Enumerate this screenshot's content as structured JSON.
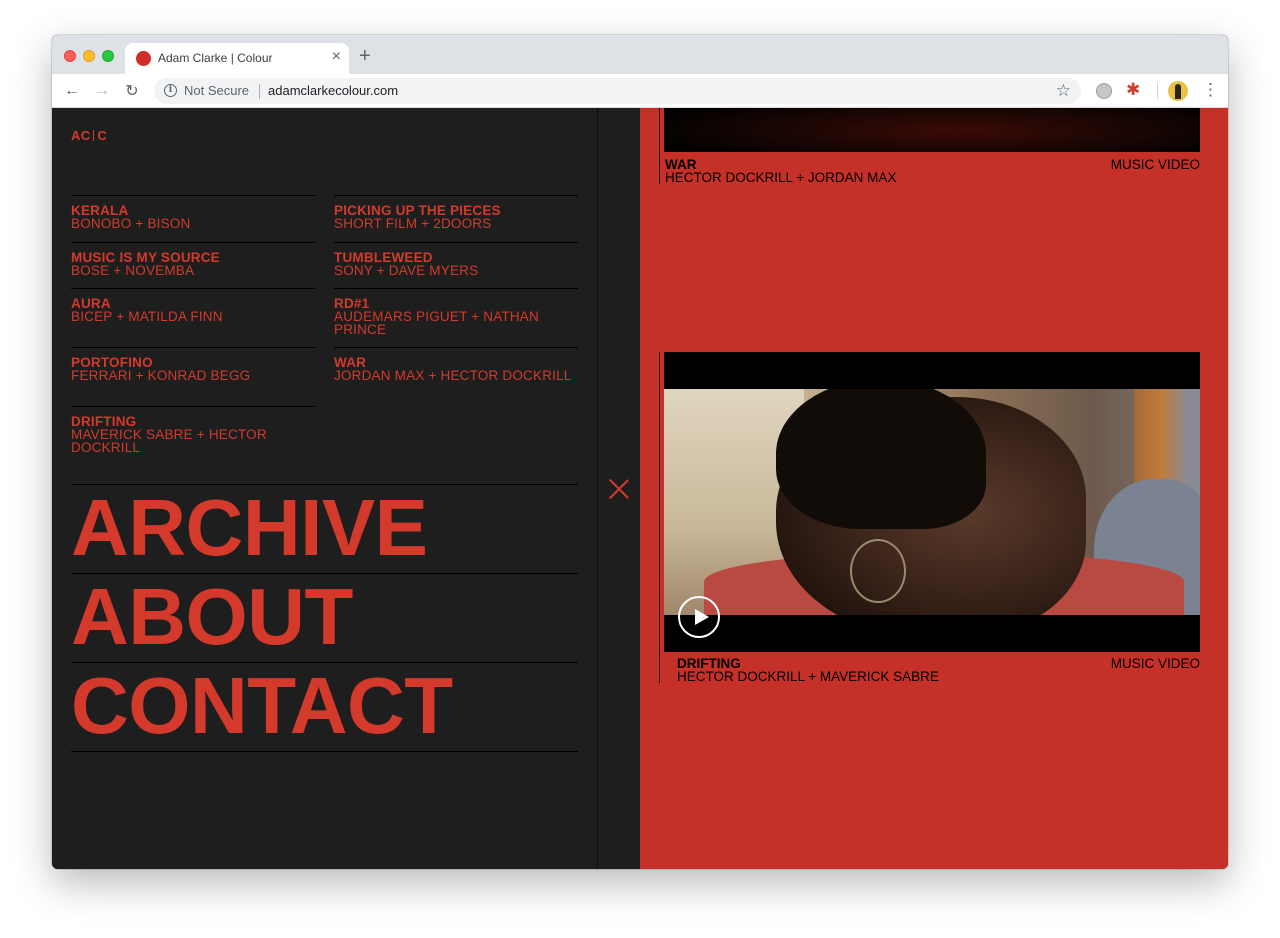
{
  "browser": {
    "tab_title": "Adam Clarke | Colour",
    "tab_close": "×",
    "new_tab": "+",
    "back": "←",
    "forward": "→",
    "reload": "↻",
    "info": "i",
    "security_label": "Not Secure",
    "url": "adamclarkecolour.com",
    "bookmark": "☆",
    "menu": "⋮",
    "extension_star": "✱"
  },
  "site": {
    "logo_left": "AC",
    "logo_right": "C"
  },
  "projects": [
    {
      "title": "KERALA",
      "subtitle": "BONOBO + BISON"
    },
    {
      "title": "PICKING UP THE PIECES",
      "subtitle": "SHORT FILM + 2DOORS"
    },
    {
      "title": "MUSIC IS MY SOURCE",
      "subtitle": "BOSE + NOVEMBA"
    },
    {
      "title": "TUMBLEWEED",
      "subtitle": "SONY + DAVE MYERS"
    },
    {
      "title": "AURA",
      "subtitle": "BICEP + MATILDA FINN"
    },
    {
      "title": "RD#1",
      "subtitle": "AUDEMARS PIGUET + NATHAN PRINCE"
    },
    {
      "title": "PORTOFINO",
      "subtitle": "FERRARI + KONRAD BEGG"
    },
    {
      "title": "WAR",
      "subtitle": "JORDAN MAX + HECTOR DOCKRILL"
    },
    {
      "title": "DRIFTING",
      "subtitle": "MAVERICK SABRE + HECTOR DOCKRILL"
    }
  ],
  "nav": {
    "archive": "ARCHIVE",
    "about": "ABOUT",
    "contact": "CONTACT"
  },
  "videos": [
    {
      "title": "WAR",
      "credits": "HECTOR DOCKRILL + JORDAN MAX",
      "category": "MUSIC VIDEO"
    },
    {
      "title": "DRIFTING",
      "credits": "HECTOR DOCKRILL + MAVERICK SABRE",
      "category": "MUSIC VIDEO"
    }
  ],
  "colors": {
    "accent": "#d33a2c",
    "panel_dark": "#1e1e1e",
    "panel_red": "#c53128"
  }
}
